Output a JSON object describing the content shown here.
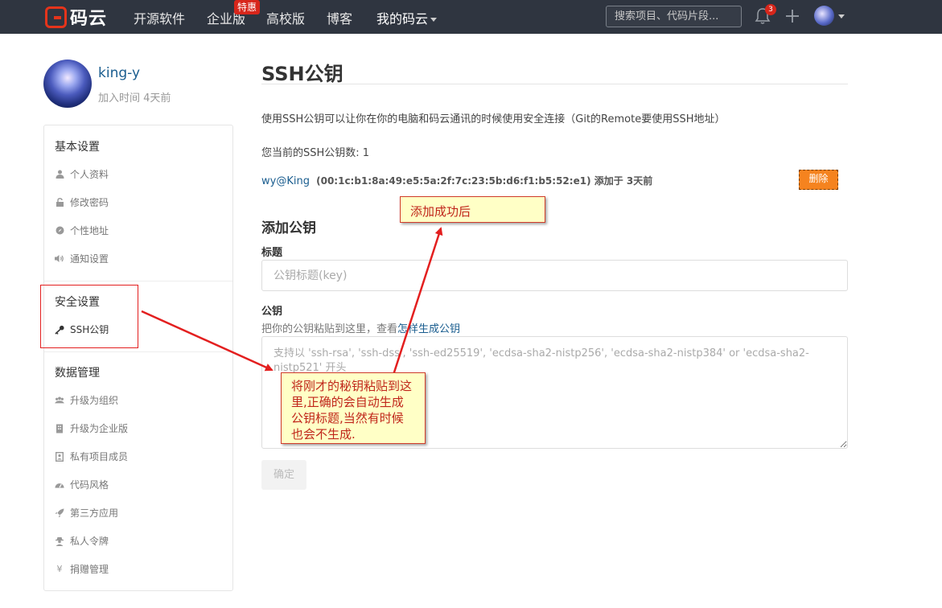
{
  "nav": {
    "logo_text": "码云",
    "items": [
      "开源软件",
      "企业版",
      "高校版",
      "博客",
      "我的码云"
    ],
    "enterprise_badge": "特惠",
    "search_placeholder": "搜索项目、代码片段...",
    "notification_count": "3"
  },
  "profile": {
    "username": "king-y",
    "joined": "加入时间 4天前"
  },
  "sidebar": {
    "basic_title": "基本设置",
    "basic_items": [
      "个人资料",
      "修改密码",
      "个性地址",
      "通知设置"
    ],
    "security_title": "安全设置",
    "security_items": [
      "SSH公钥"
    ],
    "data_title": "数据管理",
    "data_items": [
      "升级为组织",
      "升级为企业版",
      "私有项目成员",
      "代码风格",
      "第三方应用",
      "私人令牌",
      "捐赠管理"
    ]
  },
  "main": {
    "title": "SSH公钥",
    "description": "使用SSH公钥可以让你在你的电脑和码云通讯的时候使用安全连接（Git的Remote要使用SSH地址）",
    "count_text": "您当前的SSH公钥数: 1",
    "key": {
      "name": "wy@King",
      "fingerprint": "(00:1c:b1:8a:49:e5:5a:2f:7c:23:5b:d6:f1:b5:52:e1)",
      "added": "添加于 3天前",
      "delete_label": "删除"
    },
    "add_title": "添加公钥",
    "title_label": "标题",
    "title_placeholder": "公钥标题(key)",
    "key_label": "公钥",
    "key_hint": "把你的公钥粘贴到这里，查看",
    "key_hint_link": "怎样生成公钥",
    "key_placeholder": "支持以 'ssh-rsa', 'ssh-dss', 'ssh-ed25519', 'ecdsa-sha2-nistp256', 'ecdsa-sha2-nistp384' or 'ecdsa-sha2-nistp521' 开头",
    "confirm_label": "确定"
  },
  "annotations": {
    "note_success": "添加成功后",
    "note_paste": "将刚才的秘钥粘贴到这里,正确的会自动生成公钥标题,当然有时候也会不生成."
  },
  "colors": {
    "topbar": "#2f3540",
    "link": "#1a5d8f",
    "delete_button": "#f5831f",
    "annotation_red": "#e31f1f",
    "note_bg": "#ffffc6"
  }
}
